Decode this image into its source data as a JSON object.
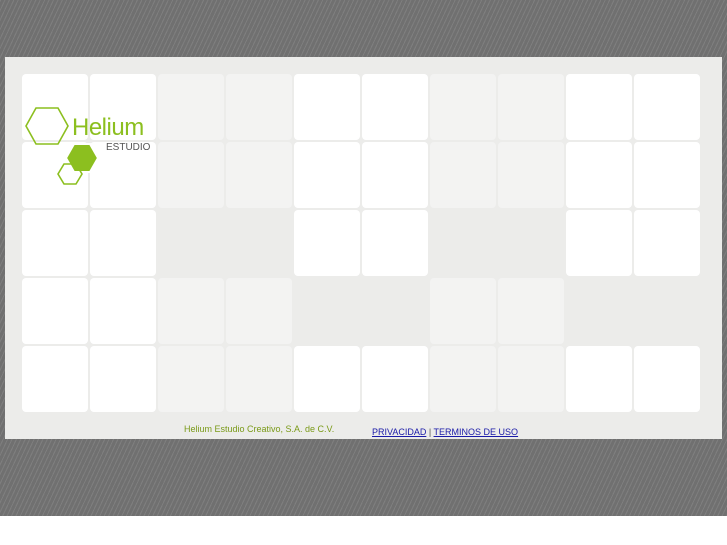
{
  "logo": {
    "word": "Helium",
    "subtitle": "ESTUDIO",
    "accent_color": "#8cbf1f"
  },
  "grid": {
    "rows": [
      [
        "white",
        "white",
        "light",
        "light",
        "white",
        "white",
        "light",
        "light",
        "white",
        "white"
      ],
      [
        "white",
        "white",
        "light",
        "light",
        "white",
        "white",
        "light",
        "light",
        "white",
        "white"
      ],
      [
        "white",
        "white",
        "none",
        "none",
        "white",
        "white",
        "none",
        "none",
        "white",
        "white"
      ],
      [
        "white",
        "white",
        "light",
        "light",
        "none",
        "none",
        "light",
        "light",
        "none",
        "none"
      ],
      [
        "white",
        "white",
        "light",
        "light",
        "white",
        "white",
        "light",
        "light",
        "white",
        "white"
      ]
    ]
  },
  "footer": {
    "company": "Helium Estudio Creativo, S.A. de C.V.",
    "privacy_label": "PRIVACIDAD",
    "separator": "|",
    "terms_label": "TERMINOS DE USO"
  }
}
